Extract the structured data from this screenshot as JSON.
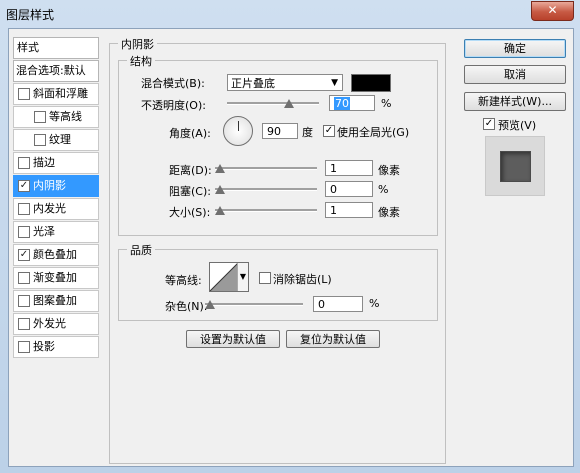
{
  "window": {
    "title": "图层样式",
    "close_glyph": "✕"
  },
  "sidebar": {
    "header": "样式",
    "blend_options": "混合选项:默认",
    "items": [
      {
        "label": "斜面和浮雕",
        "checked": false,
        "sub": false,
        "selected": false
      },
      {
        "label": "等高线",
        "checked": false,
        "sub": true,
        "selected": false
      },
      {
        "label": "纹理",
        "checked": false,
        "sub": true,
        "selected": false
      },
      {
        "label": "描边",
        "checked": false,
        "sub": false,
        "selected": false
      },
      {
        "label": "内阴影",
        "checked": true,
        "sub": false,
        "selected": true
      },
      {
        "label": "内发光",
        "checked": false,
        "sub": false,
        "selected": false
      },
      {
        "label": "光泽",
        "checked": false,
        "sub": false,
        "selected": false
      },
      {
        "label": "颜色叠加",
        "checked": true,
        "sub": false,
        "selected": false
      },
      {
        "label": "渐变叠加",
        "checked": false,
        "sub": false,
        "selected": false
      },
      {
        "label": "图案叠加",
        "checked": false,
        "sub": false,
        "selected": false
      },
      {
        "label": "外发光",
        "checked": false,
        "sub": false,
        "selected": false
      },
      {
        "label": "投影",
        "checked": false,
        "sub": false,
        "selected": false
      }
    ]
  },
  "panel": {
    "title": "内阴影",
    "structure": {
      "title": "结构",
      "blend_mode_label": "混合模式(B):",
      "blend_mode_value": "正片叠底",
      "shadow_color": "#000000",
      "opacity_label": "不透明度(O):",
      "opacity_value": "70",
      "opacity_fraction": 0.7,
      "opacity_unit": "%",
      "angle_label": "角度(A):",
      "angle_value": "90",
      "angle_unit": "度",
      "global_light_label": "使用全局光(G)",
      "global_light_checked": true,
      "distance_label": "距离(D):",
      "distance_value": "1",
      "distance_fraction": 0.0,
      "distance_unit": "像素",
      "choke_label": "阻塞(C):",
      "choke_value": "0",
      "choke_fraction": 0.0,
      "choke_unit": "%",
      "size_label": "大小(S):",
      "size_value": "1",
      "size_fraction": 0.0,
      "size_unit": "像素"
    },
    "quality": {
      "title": "品质",
      "contour_label": "等高线:",
      "antialias_label": "消除锯齿(L)",
      "antialias_checked": false,
      "noise_label": "杂色(N):",
      "noise_value": "0",
      "noise_fraction": 0.0,
      "noise_unit": "%"
    },
    "set_default_label": "设置为默认值",
    "reset_default_label": "复位为默认值"
  },
  "buttons": {
    "ok": "确定",
    "cancel": "取消",
    "new_style": "新建样式(W)...",
    "preview_label": "预览(V)",
    "preview_checked": true
  },
  "icons": {
    "check": "✓",
    "dropdown": "▼"
  }
}
